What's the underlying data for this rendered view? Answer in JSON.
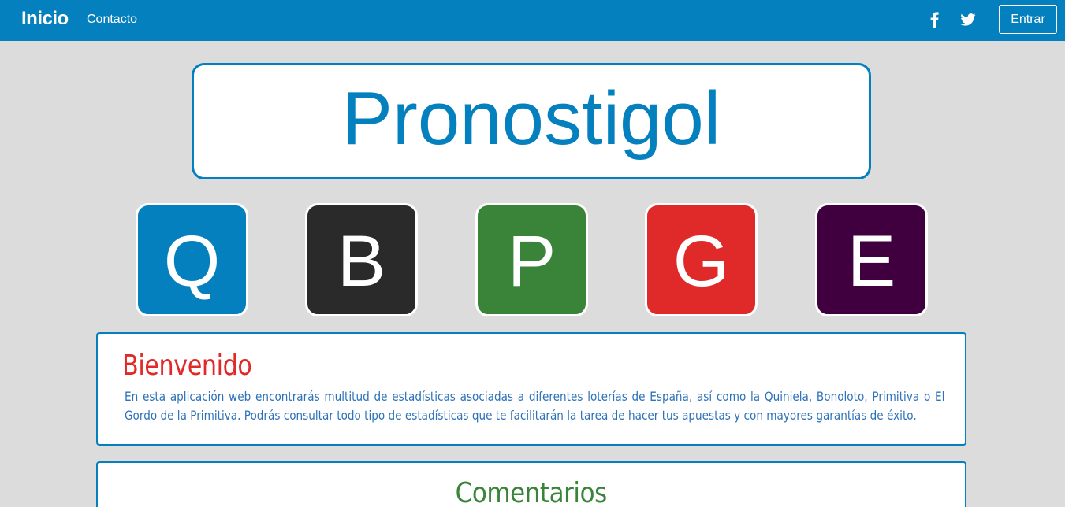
{
  "navbar": {
    "brand": "Inicio",
    "links": [
      {
        "label": "Contacto"
      }
    ],
    "social": [
      {
        "icon": "facebook-icon"
      },
      {
        "icon": "twitter-icon"
      }
    ],
    "login_label": "Entrar",
    "background": "#0480be"
  },
  "title": {
    "text": "Pronostigol",
    "color": "#0480be"
  },
  "tiles": [
    {
      "letter": "Q",
      "color": "#0480be"
    },
    {
      "letter": "B",
      "color": "#2a2a2a"
    },
    {
      "letter": "P",
      "color": "#3a843a"
    },
    {
      "letter": "G",
      "color": "#e02a29"
    },
    {
      "letter": "E",
      "color": "#400040"
    }
  ],
  "welcome": {
    "title": "Bienvenido",
    "text": "En esta aplicación web encontrarás multitud de estadísticas asociadas a diferentes loterías de España, así como la Quiniela, Bonoloto, Primitiva o El Gordo de la Primitiva. Podrás consultar todo tipo de estadísticas que te facilitarán la tarea de hacer tus apuestas y con mayores garantías de éxito.",
    "title_color": "#e02a29",
    "text_color": "#2d72b8"
  },
  "comments": {
    "title": "Comentarios",
    "title_color": "#3a843a"
  }
}
